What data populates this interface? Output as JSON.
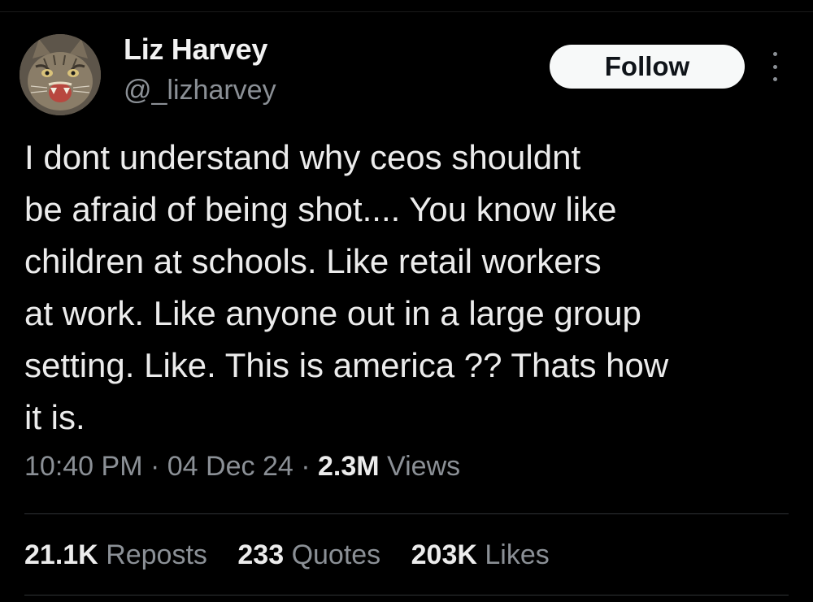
{
  "user": {
    "display_name": "Liz Harvey",
    "handle": "@_lizharvey",
    "avatar_icon": "cat-avatar"
  },
  "actions": {
    "follow_label": "Follow",
    "more_icon": "more-vertical-icon"
  },
  "tweet": {
    "lines": [
      "I dont understand why ceos shouldnt",
      "be afraid of being shot.... You know like",
      "children at schools. Like retail workers",
      "at work. Like anyone out in a large group",
      "setting. Like. This is america ?? Thats how",
      "it is."
    ]
  },
  "meta": {
    "time": "10:40 PM",
    "separator": "·",
    "date": "04 Dec 24",
    "views_count": "2.3M",
    "views_label": "Views"
  },
  "stats": [
    {
      "count": "21.1K",
      "label": "Reposts"
    },
    {
      "count": "233",
      "label": "Quotes"
    },
    {
      "count": "203K",
      "label": "Likes"
    }
  ],
  "colors": {
    "background": "#000000",
    "text": "#e7e9ea",
    "muted": "#8b9096",
    "button_bg": "#f7f9f9",
    "button_text": "#0f1419",
    "divider": "#2f3336"
  }
}
